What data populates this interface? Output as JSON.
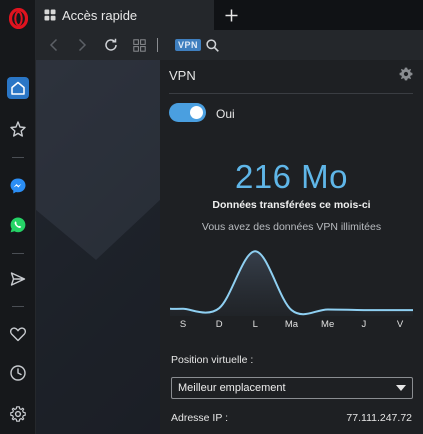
{
  "browser": {
    "tab": {
      "label": "Accès rapide",
      "icon": "speed-dial-grid-icon"
    },
    "new_tab_icon": "plus-icon",
    "toolbar": {
      "back_icon": "chevron-left-icon",
      "forward_icon": "chevron-right-icon",
      "reload_icon": "reload-icon",
      "speed_dial_icon": "grid-icon",
      "vpn_badge": "VPN",
      "search_icon": "search-icon"
    },
    "sidebar": {
      "items": [
        {
          "name": "home",
          "icon": "home-icon",
          "active": true
        },
        {
          "name": "bookmarks",
          "icon": "star-icon"
        },
        {
          "name": "messenger",
          "icon": "messenger-icon"
        },
        {
          "name": "whatsapp",
          "icon": "whatsapp-icon"
        },
        {
          "name": "send",
          "icon": "send-icon"
        },
        {
          "name": "favorites",
          "icon": "heart-icon"
        },
        {
          "name": "history",
          "icon": "clock-icon"
        },
        {
          "name": "settings",
          "icon": "gear-icon"
        }
      ]
    }
  },
  "vpn": {
    "title": "VPN",
    "toggle": {
      "on": true,
      "label": "Oui"
    },
    "data_amount": "216 Mo",
    "data_caption": "Données transférées ce mois-ci",
    "data_sub": "Vous avez des données VPN illimitées",
    "days": [
      "S",
      "D",
      "L",
      "Ma",
      "Me",
      "J",
      "V"
    ],
    "usage_levels": [
      0.05,
      0.06,
      0.95,
      0.03,
      0.04,
      0.03,
      0.03
    ],
    "position_label": "Position virtuelle :",
    "location": "Meilleur emplacement",
    "ip_label": "Adresse IP :",
    "ip_value": "77.111.247.72"
  },
  "colors": {
    "accent": "#5fb6e8",
    "toggle": "#4a9fe0",
    "opera_red": "#e0131f",
    "active_sidebar": "#2a76c6",
    "background": "#1e2023"
  }
}
